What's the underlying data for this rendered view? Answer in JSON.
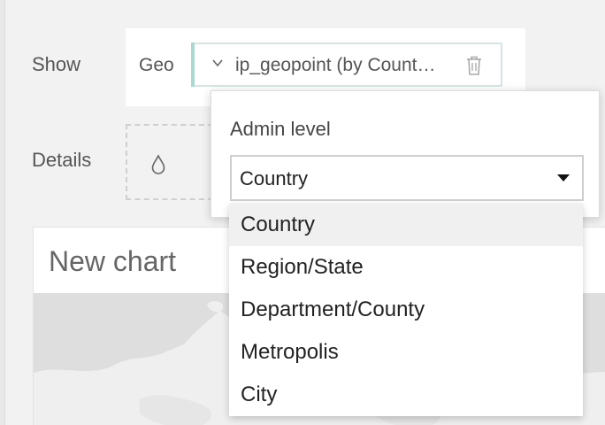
{
  "shelves": {
    "show_label": "Show",
    "details_label": "Details",
    "geo": {
      "label": "Geo",
      "field": "ip_geopoint (by Count…",
      "icons": {
        "expand": "chevron-down-icon",
        "remove": "trash-icon"
      }
    },
    "details": {
      "icon": "droplet-icon"
    }
  },
  "chart": {
    "title": "New chart"
  },
  "admin_level": {
    "label": "Admin level",
    "selected": "Country",
    "options": [
      "Country",
      "Region/State",
      "Department/County",
      "Metropolis",
      "City"
    ]
  },
  "colors": {
    "accent": "#a9d9d0",
    "background": "#f2f2f2",
    "map": "#dedede"
  }
}
